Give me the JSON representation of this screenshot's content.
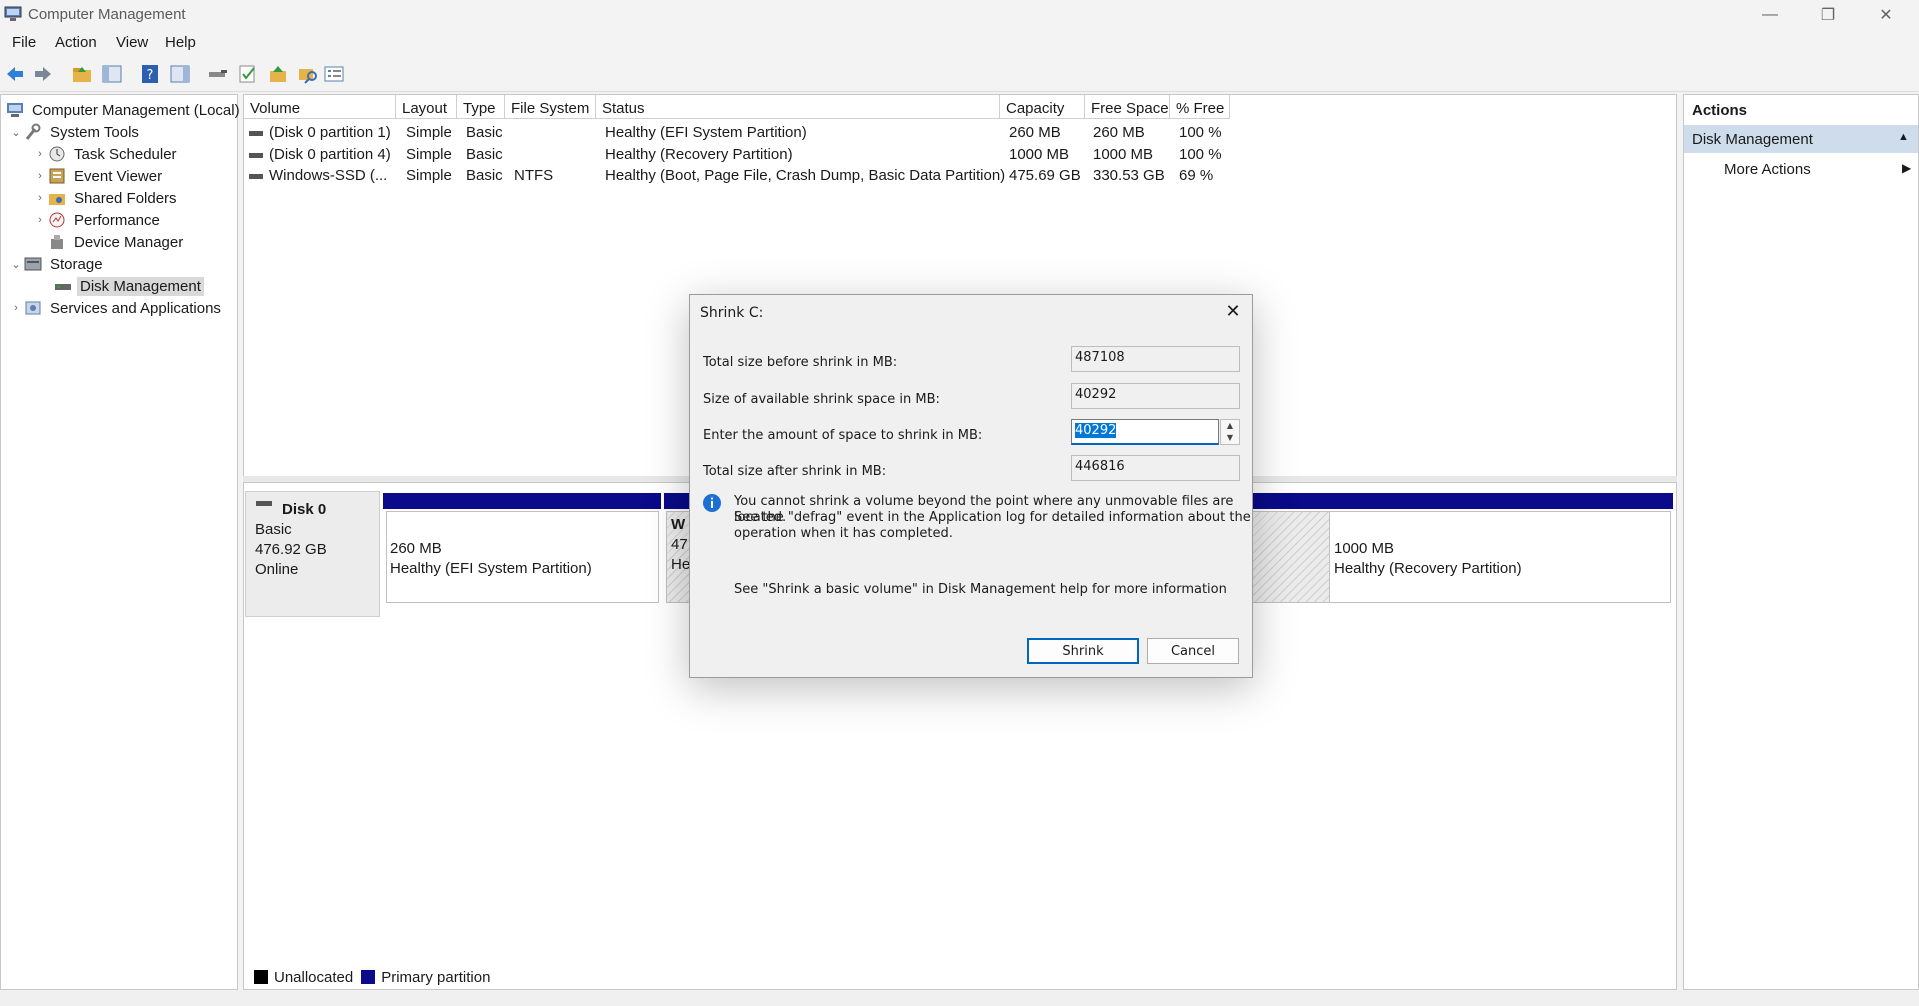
{
  "window": {
    "title": "Computer Management",
    "minimize": "—",
    "maximize": "❐",
    "close": "✕"
  },
  "menu": [
    "File",
    "Action",
    "View",
    "Help"
  ],
  "tree": {
    "root": "Computer Management (Local)",
    "system_tools": "System Tools",
    "task_scheduler": "Task Scheduler",
    "event_viewer": "Event Viewer",
    "shared_folders": "Shared Folders",
    "performance": "Performance",
    "device_manager": "Device Manager",
    "storage": "Storage",
    "disk_management": "Disk Management",
    "services": "Services and Applications"
  },
  "volumes": {
    "columns": [
      "Volume",
      "Layout",
      "Type",
      "File System",
      "Status",
      "Capacity",
      "Free Space",
      "% Free"
    ],
    "rows": [
      [
        "(Disk 0 partition 1)",
        "Simple",
        "Basic",
        "",
        "Healthy (EFI System Partition)",
        "260 MB",
        "260 MB",
        "100 %"
      ],
      [
        "(Disk 0 partition 4)",
        "Simple",
        "Basic",
        "",
        "Healthy (Recovery Partition)",
        "1000 MB",
        "1000 MB",
        "100 %"
      ],
      [
        "Windows-SSD (...",
        "Simple",
        "Basic",
        "NTFS",
        "Healthy (Boot, Page File, Crash Dump, Basic Data Partition)",
        "475.69 GB",
        "330.53 GB",
        "69 %"
      ]
    ]
  },
  "disk": {
    "name": "Disk 0",
    "type": "Basic",
    "size": "476.92 GB",
    "state": "Online",
    "part1_size": "260 MB",
    "part1_status": "Healthy (EFI System Partition)",
    "part2_name_fragment": "W",
    "part2_size_fragment": "47",
    "part2_status_fragment": "He",
    "part3_size": "1000 MB",
    "part3_status": "Healthy (Recovery Partition)"
  },
  "legend": {
    "unallocated": "Unallocated",
    "primary": "Primary partition",
    "unallocated_color": "#000000",
    "primary_color": "#0a0a8a"
  },
  "actions": {
    "title": "Actions",
    "section": "Disk Management",
    "more": "More Actions"
  },
  "dialog": {
    "title": "Shrink C:",
    "label_total_before": "Total size before shrink in MB:",
    "value_total_before": "487108",
    "label_available": "Size of available shrink space in MB:",
    "value_available": "40292",
    "label_amount": "Enter the amount of space to shrink in MB:",
    "value_amount": "40292",
    "label_total_after": "Total size after shrink in MB:",
    "value_total_after": "446816",
    "info_line1": "You cannot shrink a volume beyond the point where any unmovable files are located.",
    "info_line2": "See the \"defrag\" event in the Application log for detailed information about the",
    "info_line3": "operation when it has completed.",
    "help_text": "See \"Shrink a basic volume\" in Disk Management help for more information",
    "shrink_button": "Shrink",
    "cancel_button": "Cancel"
  }
}
